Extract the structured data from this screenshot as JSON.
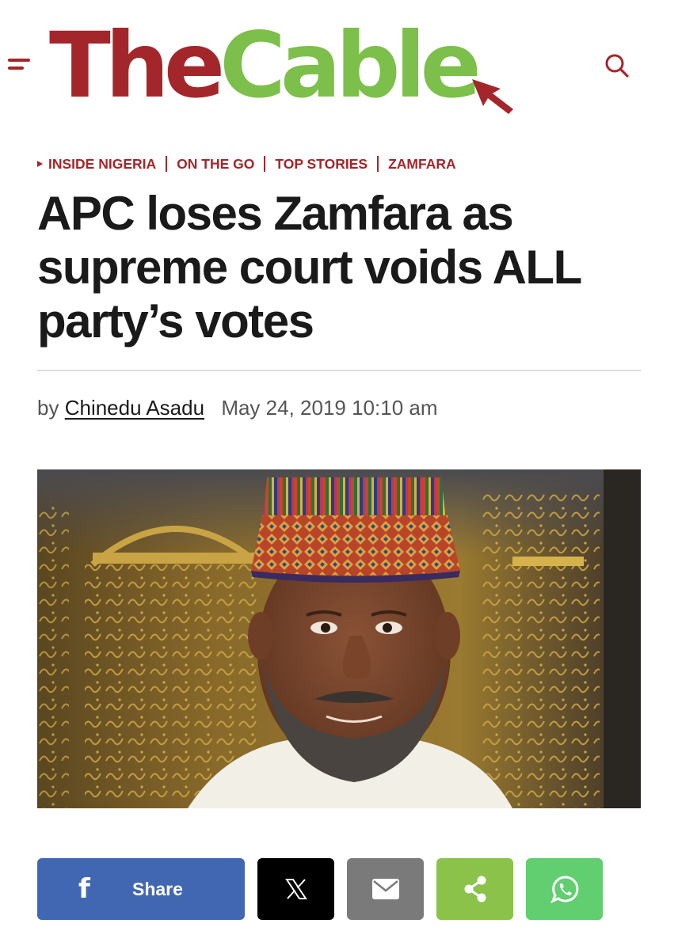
{
  "header": {
    "logo_the": "The",
    "logo_cable": "Cable",
    "menu_icon": "hamburger-menu-icon",
    "search_icon": "search-icon",
    "brand_red": "#a3262a",
    "brand_green": "#7cbf4a"
  },
  "categories": [
    {
      "label": "INSIDE NIGERIA"
    },
    {
      "label": "ON THE GO"
    },
    {
      "label": "TOP STORIES"
    },
    {
      "label": "ZAMFARA"
    }
  ],
  "article": {
    "headline": "APC loses Zamfara as supreme court voids ALL party’s votes",
    "by_prefix": "by",
    "author": "Chinedu Asadu",
    "date": "May 24, 2019 10:10 am",
    "image_icon": "portrait-photo"
  },
  "share": {
    "facebook_label": "Share",
    "facebook_color": "#4267b2",
    "x_color": "#000000",
    "email_color": "#7a7a7a",
    "share_color": "#8bc34a",
    "whatsapp_color": "#61ce70",
    "icons": [
      "facebook-icon",
      "x-icon",
      "email-icon",
      "share-icon",
      "whatsapp-icon"
    ]
  }
}
